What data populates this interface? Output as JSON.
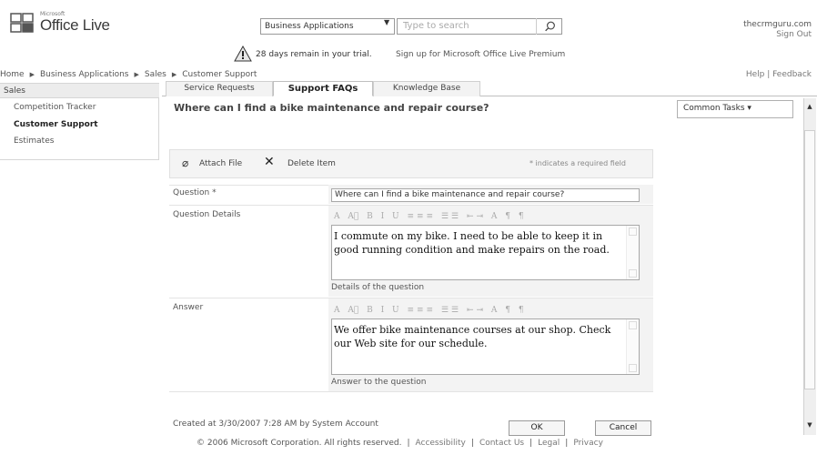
{
  "header": {
    "logo_brand": "Microsoft",
    "logo_text": "Office Live",
    "scope_select": "Business Applications",
    "search_placeholder": "Type to search",
    "user": "thecrmguru.com",
    "sign_out": "Sign Out",
    "trial_message": "28 days remain in your trial.",
    "trial_link": "Sign up for Microsoft Office Live Premium"
  },
  "breadcrumb": [
    "Home",
    "Business Applications",
    "Sales",
    "Customer Support"
  ],
  "help": "Help",
  "feedback": "Feedback",
  "sidebar": {
    "heading": "Sales",
    "items": [
      {
        "label": "Competition Tracker"
      },
      {
        "label": "Customer Support"
      },
      {
        "label": "Estimates"
      }
    ]
  },
  "tabs": [
    {
      "label": "Service Requests"
    },
    {
      "label": "Support FAQs"
    },
    {
      "label": "Knowledge Base"
    }
  ],
  "main": {
    "title": "Where can I find a bike maintenance and repair course?",
    "common_tasks": "Common Tasks ▾"
  },
  "toolbar": {
    "attach": "Attach File",
    "delete": "Delete Item",
    "required_note": "* indicates a required field"
  },
  "form": {
    "question_label": "Question *",
    "question_value": "Where can I find a bike maintenance and repair course?",
    "details_label": "Question Details",
    "details_text": "I commute on my bike. I need to be able to keep it in good running condition and make repairs on the road.",
    "details_hint": "Details of the question",
    "answer_label": "Answer",
    "answer_text": "We offer bike maintenance courses at our shop. Check our Web site for our schedule.",
    "answer_hint": "Answer to the question",
    "rte_toolbar": "A A⃞ B I U ≡≡≡ ☰☰ ⇤⇥ A ¶ ¶"
  },
  "footer": {
    "created": "Created at 3/30/2007 7:28 AM  by System Account",
    "ok": "OK",
    "cancel": "Cancel",
    "copyright": "© 2006 Microsoft Corporation. All rights reserved.",
    "accessibility": "Accessibility",
    "contact": "Contact Us",
    "legal": "Legal",
    "privacy": "Privacy"
  }
}
